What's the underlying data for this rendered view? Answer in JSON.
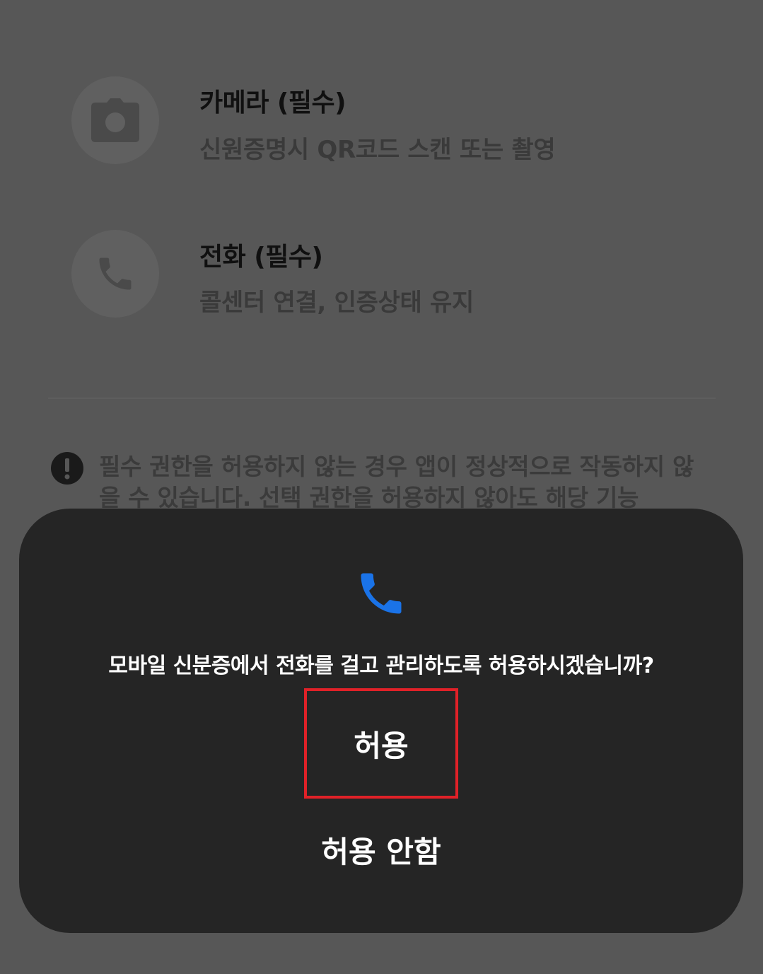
{
  "permissions": [
    {
      "title": "카메라 (필수)",
      "description": "신원증명시 QR코드 스캔 또는 촬영",
      "icon": "camera-icon"
    },
    {
      "title": "전화 (필수)",
      "description": "콜센터 연결, 인증상태 유지",
      "icon": "phone-icon"
    }
  ],
  "notice": {
    "icon": "exclamation-icon",
    "text": "필수 권한을 허용하지 않는 경우 앱이 정상적으로 작동하지 않을 수 있습니다. 선택 권한을 허용하지 않아도 해당 기능"
  },
  "dialog": {
    "icon": "phone-icon",
    "icon_color": "#1a73e8",
    "message": "모바일 신분증에서 전화를 걸고 관리하도록 허용하시겠습니까?",
    "allow_label": "허용",
    "deny_label": "허용 안함",
    "highlight_color": "#e02128"
  }
}
